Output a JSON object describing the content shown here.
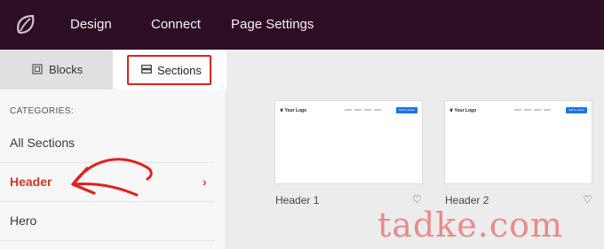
{
  "topbar": {
    "logo_icon": "leaf-icon",
    "nav": {
      "design": "Design",
      "connect": "Connect",
      "page_settings": "Page Settings"
    }
  },
  "sidebar": {
    "tabs": [
      {
        "label": "Blocks",
        "icon": "blocks-icon",
        "active": false
      },
      {
        "label": "Sections",
        "icon": "sections-icon",
        "active": true
      }
    ],
    "categories_title": "CATEGORIES:",
    "categories": [
      {
        "label": "All Sections",
        "active": false
      },
      {
        "label": "Header",
        "active": true,
        "icon": "chevron-right-icon"
      },
      {
        "label": "Hero",
        "active": false
      }
    ]
  },
  "sections": [
    {
      "name": "Header 1",
      "preview": {
        "logo_text": "Your Logo",
        "button_text": "Call To Action"
      }
    },
    {
      "name": "Header 2",
      "preview": {
        "logo_text": "Your Logo",
        "button_text": "Call To Action"
      }
    }
  ],
  "annotation": {
    "highlight_color": "#e0231c",
    "arrow_color": "#e0231c"
  },
  "watermark": "tadke.com",
  "colors": {
    "topbar": "#2d0e24",
    "active_category": "#d13a24",
    "preview_button": "#1a73e8"
  }
}
